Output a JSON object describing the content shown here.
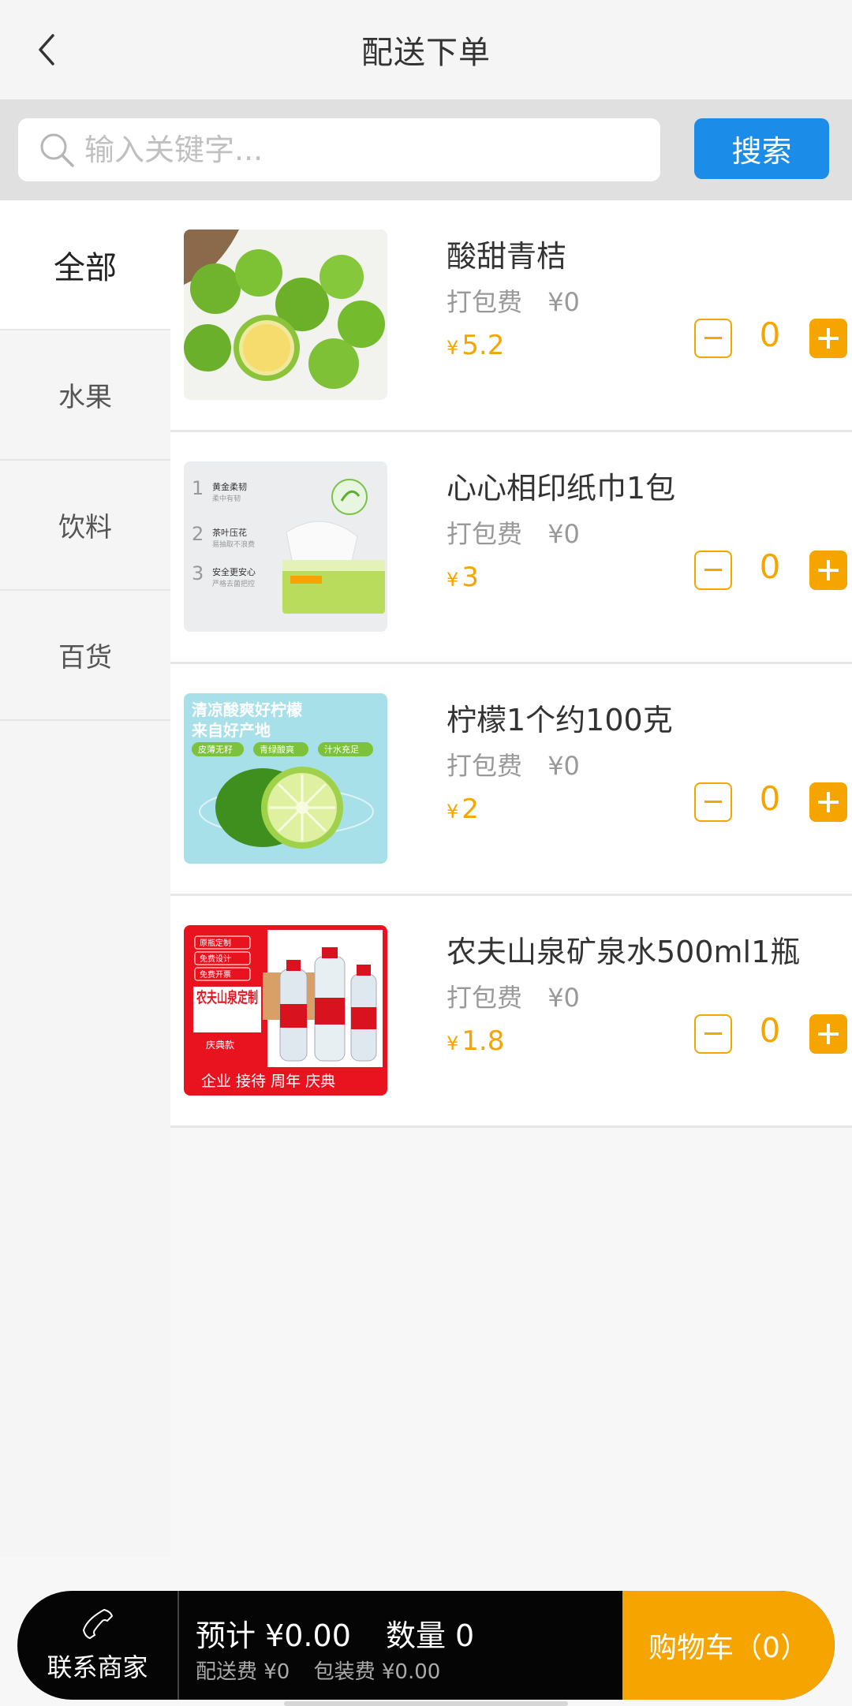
{
  "header": {
    "title": "配送下单"
  },
  "search": {
    "placeholder": "输入关键字...",
    "button_label": "搜索"
  },
  "sidebar": {
    "items": [
      {
        "label": "全部",
        "active": true
      },
      {
        "label": "水果",
        "active": false
      },
      {
        "label": "饮料",
        "active": false
      },
      {
        "label": "百货",
        "active": false
      }
    ]
  },
  "products": [
    {
      "name": "酸甜青桔",
      "fee_label": "打包费",
      "fee_value": "¥0",
      "currency": "¥",
      "price": "5.2",
      "qty": "0"
    },
    {
      "name": "心心相印纸巾1包",
      "fee_label": "打包费",
      "fee_value": "¥0",
      "currency": "¥",
      "price": "3",
      "qty": "0",
      "image_text": {
        "line1": "黄金柔韧",
        "line1_sub": "柔中有韧",
        "line2": "茶叶压花",
        "line2_sub": "易抽取不浪费",
        "line3": "安全更安心",
        "line3_sub": "严格去菌把控"
      }
    },
    {
      "name": "柠檬1个约100克",
      "fee_label": "打包费",
      "fee_value": "¥0",
      "currency": "¥",
      "price": "2",
      "qty": "0",
      "image_text": {
        "headline1": "清凉酸爽好柠檬",
        "headline2": "来自好产地",
        "tag1": "皮薄无籽",
        "tag2": "青绿酸爽",
        "tag3": "汁水充足"
      }
    },
    {
      "name": "农夫山泉矿泉水500ml1瓶",
      "fee_label": "打包费",
      "fee_value": "¥0",
      "currency": "¥",
      "price": "1.8",
      "qty": "0",
      "image_text": {
        "tag1": "原瓶定制",
        "tag2": "免费设计",
        "tag3": "免费开票",
        "brand": "农夫山泉定制",
        "badge": "庆典款",
        "footer": "企业 接待 周年 庆典"
      }
    }
  ],
  "bottom": {
    "contact_label": "联系商家",
    "estimate": "预计 ¥0.00",
    "quantity": "数量 0",
    "delivery_fee": "配送费 ¥0",
    "packing_fee": "包装费 ¥0.00",
    "cart_label": "购物车（0）"
  },
  "colors": {
    "accent": "#f5a400",
    "search_button": "#1b8de8",
    "bottom_bar": "#050505"
  }
}
